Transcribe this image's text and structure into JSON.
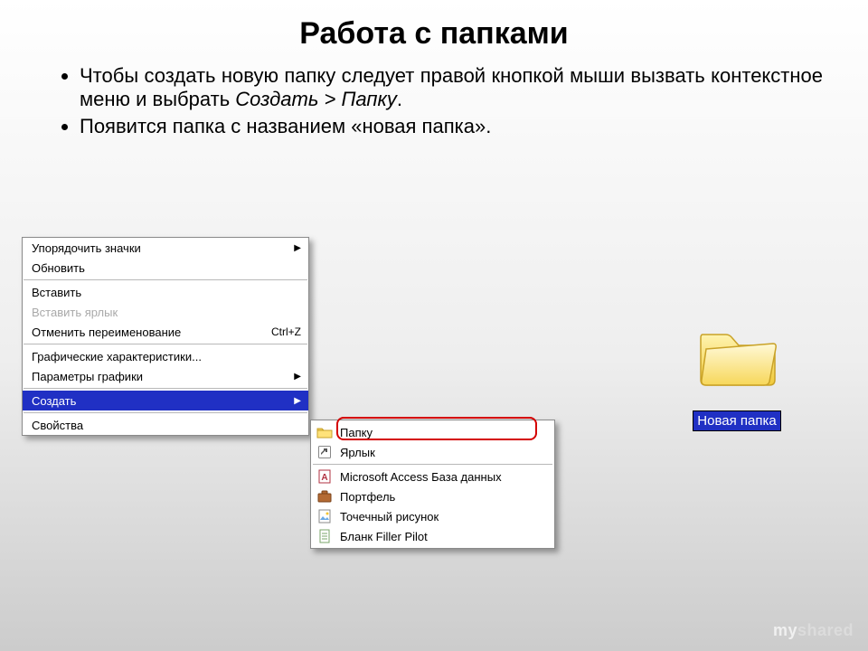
{
  "title": "Работа с папками",
  "bullets": {
    "item1_pre": "Чтобы создать новую папку следует правой кнопкой мыши вызвать контекстное меню и выбрать ",
    "item1_em": "Создать > Папку",
    "item1_post": ".",
    "item2": "Появится папка с названием «новая папка»."
  },
  "context_menu": {
    "arrange_icons": "Упорядочить значки",
    "refresh": "Обновить",
    "paste": "Вставить",
    "paste_shortcut": "Вставить ярлык",
    "undo_rename": "Отменить переименование",
    "undo_shortcut": "Ctrl+Z",
    "graphic_chars": "Графические характеристики...",
    "graphic_params": "Параметры графики",
    "create": "Создать",
    "properties": "Свойства"
  },
  "submenu": {
    "folder": "Папку",
    "shortcut": "Ярлык",
    "access": "Microsoft Access База данных",
    "briefcase": "Портфель",
    "bitmap": "Точечный рисунок",
    "filler": "Бланк Filler Pilot"
  },
  "new_folder_label": "Новая папка",
  "watermark": {
    "a": "my",
    "b": "shared"
  }
}
